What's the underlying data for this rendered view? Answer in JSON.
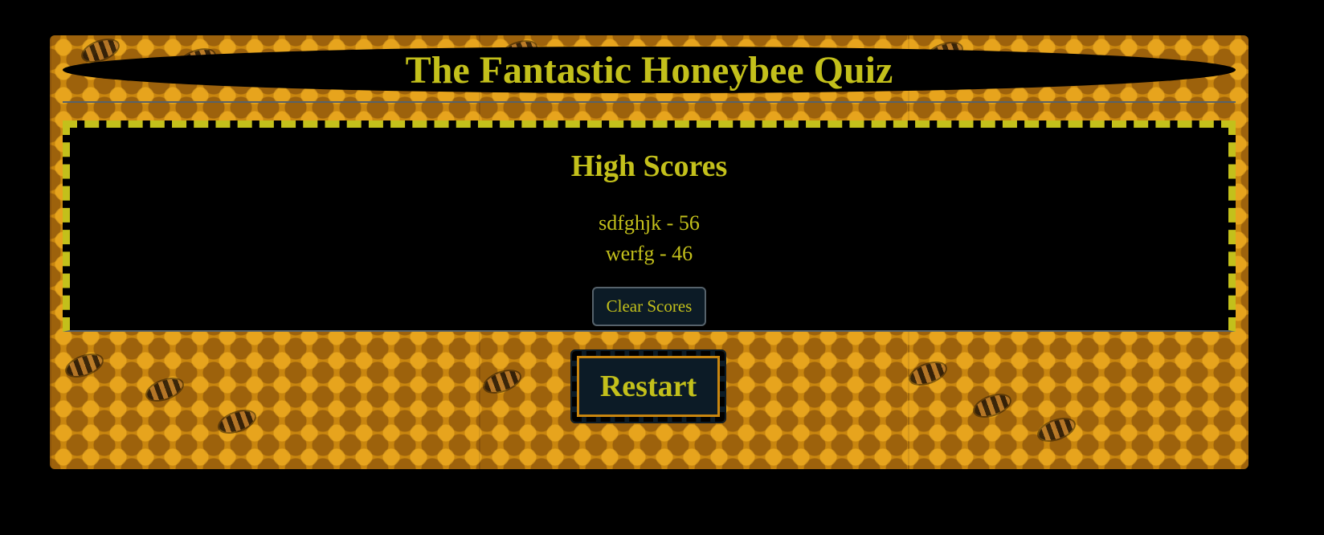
{
  "header": {
    "title": "The Fantastic Honeybee Quiz"
  },
  "high_scores": {
    "heading": "High Scores",
    "entries": [
      "sdfghjk - 56",
      "werfg - 46"
    ],
    "clear_label": "Clear Scores"
  },
  "actions": {
    "restart_label": "Restart"
  },
  "colors": {
    "page_background": "#000000",
    "accent_text": "#c3c01b",
    "panel_background": "#000000",
    "button_background": "#0c1b26",
    "divider": "#56626b",
    "honeycomb": "#c9860f"
  },
  "background": {
    "image": "honeycomb-with-bees"
  }
}
